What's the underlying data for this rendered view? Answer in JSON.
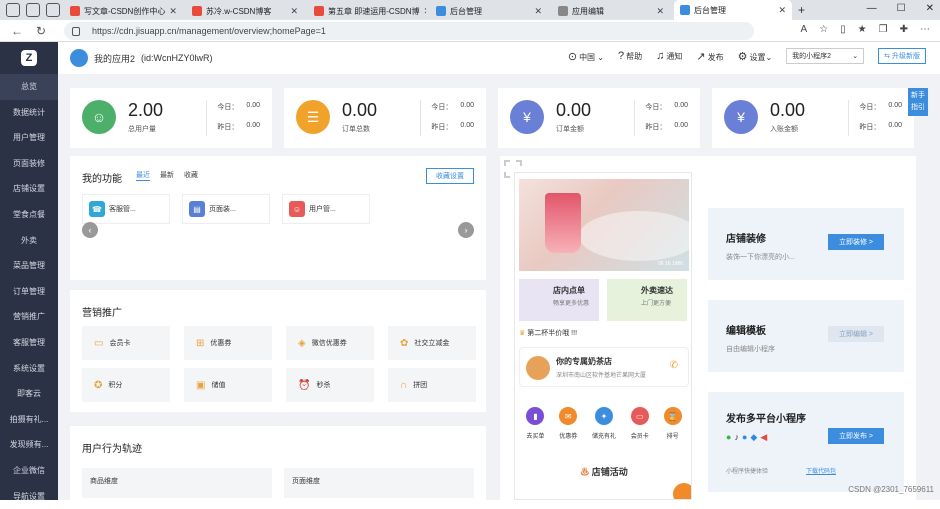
{
  "browser": {
    "tabs": [
      {
        "label": "写文章-CSDN创作中心",
        "color": "#e84a3c",
        "active": false
      },
      {
        "label": "苏冷.w-CSDN博客",
        "color": "#e84a3c",
        "active": false
      },
      {
        "label": "第五章 即速运用-CSDN博",
        "color": "#e84a3c",
        "active": false
      },
      {
        "label": "后台管理",
        "color": "#3c8dde",
        "active": false
      },
      {
        "label": "应用编辑",
        "color": "#888888",
        "active": false
      },
      {
        "label": "后台管理",
        "color": "#3c8dde",
        "active": true
      }
    ],
    "url": "https://cdn.jisuapp.cn/management/overview;homePage=1"
  },
  "sidebar": {
    "items": [
      "总览",
      "数据统计",
      "用户管理",
      "页面装修",
      "店铺设置",
      "堂食点餐",
      "外卖",
      "菜品管理",
      "订单管理",
      "营销推广",
      "客服管理",
      "系统设置",
      "即客云",
      "拍摄有礼...",
      "发现频有...",
      "企业微信",
      "导航设置"
    ]
  },
  "topbar": {
    "app_name": "我的应用2",
    "app_id": "(id:WcnHZY0lwR)",
    "region": "中国",
    "help": "帮助",
    "notify": "通知",
    "publish": "发布",
    "settings": "设置",
    "mini_program": "我的小程序2",
    "upgrade": "升级新版"
  },
  "stats": [
    {
      "value": "2.00",
      "label": "总用户量",
      "today_label": "今日：",
      "today": "0.00",
      "yest_label": "昨日：",
      "yest": "0.00",
      "color": "#4caf6a"
    },
    {
      "value": "0.00",
      "label": "订单总数",
      "today_label": "今日：",
      "today": "0.00",
      "yest_label": "昨日：",
      "yest": "0.00",
      "color": "#f0a22a"
    },
    {
      "value": "0.00",
      "label": "订单金额",
      "today_label": "今日：",
      "today": "0.00",
      "yest_label": "昨日：",
      "yest": "0.00",
      "color": "#6a7fd6"
    },
    {
      "value": "0.00",
      "label": "入账金额",
      "today_label": "今日：",
      "today": "0.00",
      "yest_label": "昨日：",
      "yest": "0.00",
      "color": "#6a7fd6"
    }
  ],
  "newbie": "新手指引",
  "functions": {
    "title": "我的功能",
    "tabs": [
      "最近",
      "最新",
      "收藏"
    ],
    "collect_btn": "收藏设置",
    "items": [
      {
        "label": "客服管...",
        "color": "#2fa8d8"
      },
      {
        "label": "页面装...",
        "color": "#5a7fd6"
      },
      {
        "label": "用户管...",
        "color": "#e85a5a"
      }
    ]
  },
  "marketing": {
    "title": "营销推广",
    "items": [
      "会员卡",
      "优惠券",
      "微信优惠券",
      "社交立减金",
      "积分",
      "储值",
      "秒杀",
      "拼团"
    ]
  },
  "behavior": {
    "title": "用户行为轨迹",
    "cols": [
      "商品维度",
      "页面维度"
    ]
  },
  "phone": {
    "banner_text": "06 16 1986",
    "card1_title": "店内点单",
    "card1_sub": "畅享更多优惠",
    "card2_title": "外卖速达",
    "card2_sub": "上门更方便",
    "notice": "第二杯半价哦 !!!",
    "shop_name": "你的专属奶茶店",
    "shop_addr": "深圳市南山区软件基地芒果网大厦",
    "icons": [
      {
        "label": "去买单",
        "color": "#7a4fd6"
      },
      {
        "label": "优惠券",
        "color": "#f08a2a"
      },
      {
        "label": "储充有礼",
        "color": "#3c8dde"
      },
      {
        "label": "会员卡",
        "color": "#e85a5a"
      },
      {
        "label": "排号",
        "color": "#f08a2a"
      }
    ],
    "activity": "店铺活动"
  },
  "promos": [
    {
      "title": "店铺装修",
      "sub": "装饰一下你漂亮的小...",
      "btn": "立即装修 >",
      "gray": false
    },
    {
      "title": "编辑模板",
      "sub": "自由编辑小程序",
      "btn": "立即编辑 >",
      "gray": true
    }
  ],
  "publish_card": {
    "title": "发布多平台小程序",
    "btn": "立即发布 >",
    "sub": "小程序快捷体验",
    "download": "下载代码包"
  },
  "watermark": "CSDN @2301_7659611"
}
